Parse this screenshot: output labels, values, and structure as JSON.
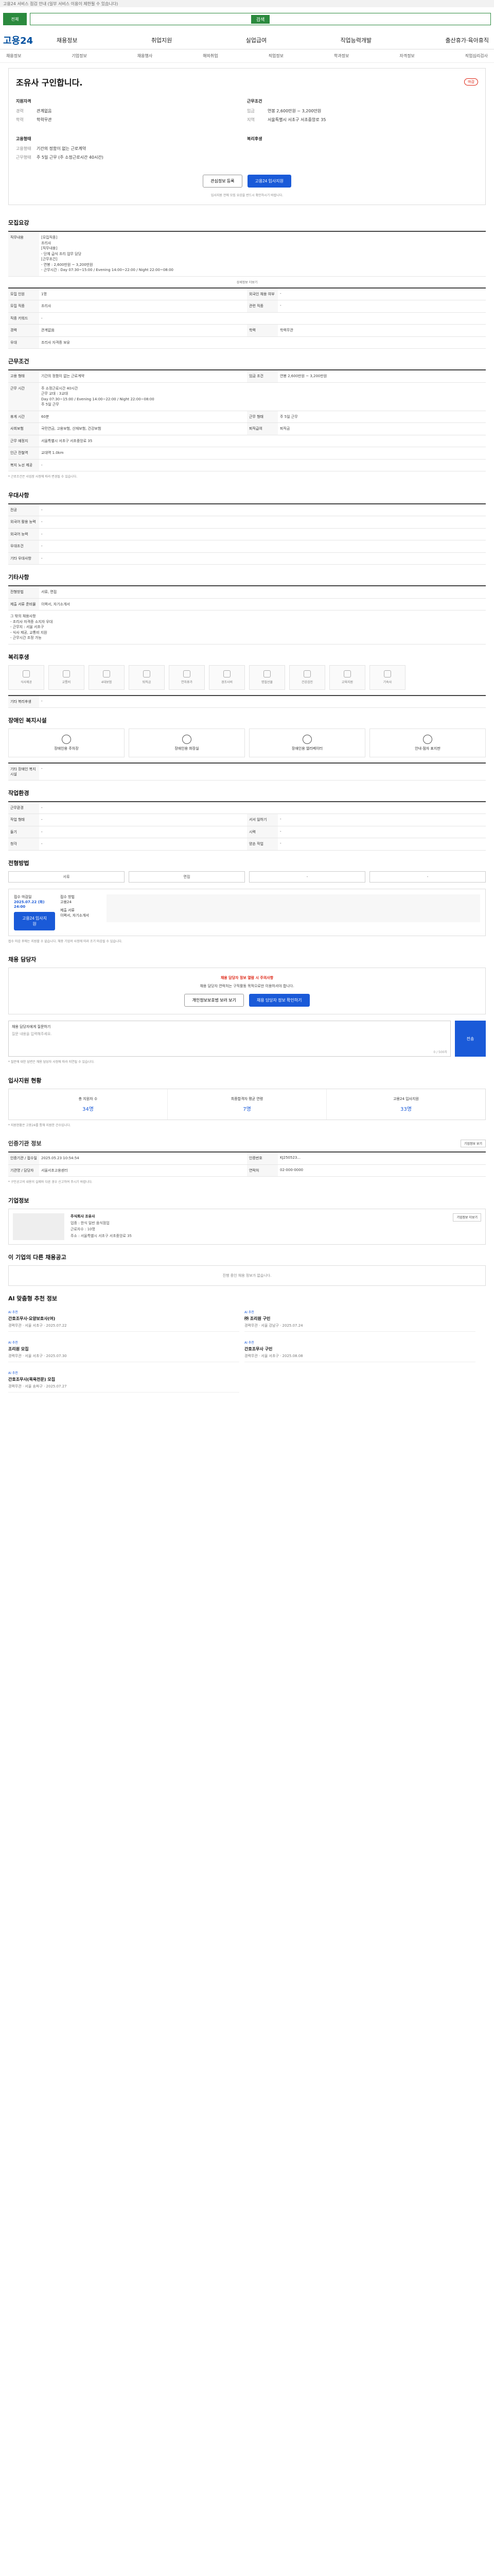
{
  "notice": "고용24 서비스 점검 안내 (일부 서비스 이용이 제한될 수 있습니다)",
  "search": {
    "scope": "전체",
    "button": "검색"
  },
  "logo": "고용24",
  "gnb": [
    "채용정보",
    "취업지원",
    "실업급여",
    "직업능력개발",
    "출산휴가·육아휴직"
  ],
  "lnb": [
    "채용정보",
    "기업정보",
    "채용행사",
    "해외취업",
    "직업정보",
    "학과정보",
    "자격정보",
    "직업심리검사"
  ],
  "company": {
    "name": "조유사 구인합니다.",
    "badge": "마감"
  },
  "summary": {
    "left_title": "지원자격",
    "left": [
      {
        "k": "경력",
        "v": "관계없음"
      },
      {
        "k": "학력",
        "v": "학력무관"
      }
    ],
    "right_title": "근무조건",
    "right": [
      {
        "k": "임금",
        "v": "연봉 2,600만원 ~ 3,200만원"
      },
      {
        "k": "지역",
        "v": "서울특별시 서초구 서초중앙로 35"
      }
    ],
    "left2_title": "고용형태",
    "left2": [
      {
        "k": "고용형태",
        "v": "기간의 정함이 없는 근로계약"
      },
      {
        "k": "근무형태",
        "v": "주 5일 근무 (주 소정근로시간 40시간)"
      }
    ],
    "right2_title": "복리후생",
    "right2": []
  },
  "buttons": {
    "scrap": "관심정보 등록",
    "apply": "고용24 입사지원"
  },
  "apply_note": "입사지원 전에 모집 요강을 반드시 확인하시기 바랍니다.",
  "recruit": {
    "title": "모집요강",
    "rows": [
      {
        "k": "직무내용",
        "v": "[모집직종]\n조리사\n[직무내용]\n- 단체 급식 조리 업무 담당\n[근무조건]\n- 연봉 : 2,600만원 ~ 3,200만원\n- 근무시간 : Day 07:30~15:00 / Evening 14:00~22:00 / Night 22:00~08:00"
      }
    ],
    "toggle": "상세정보 더보기",
    "rows2": [
      {
        "k": "모집 인원",
        "v": "1명",
        "k2": "외국인 채용 여부",
        "v2": "-"
      },
      {
        "k": "모집 직종",
        "v": "조리사",
        "k2": "관련 직종",
        "v2": "-"
      },
      {
        "k": "직종 키워드",
        "v": "-",
        "k2": "",
        "v2": ""
      },
      {
        "k": "경력",
        "v": "관계없음",
        "k2": "학력",
        "v2": "학력무관"
      },
      {
        "k": "우대",
        "v": "조리사 자격증 보유",
        "k2": "",
        "v2": ""
      }
    ]
  },
  "work": {
    "title": "근무조건",
    "rows": [
      {
        "k": "고용 형태",
        "v": "기간의 정함이 없는 근로계약",
        "k2": "임금 조건",
        "v2": "연봉 2,600만원 ~ 3,200만원"
      },
      {
        "k": "근무 시간",
        "v": "주 소정근로시간 40시간\n근무 교대 : 3교대\nDay 07:30~15:00 / Evening 14:00~22:00 / Night 22:00~08:00\n주 5일 근무",
        "k2": "",
        "v2": ""
      },
      {
        "k": "휴게 시간",
        "v": "60분",
        "k2": "근무 형태",
        "v2": "주 5일 근무"
      },
      {
        "k": "사회보험",
        "v": "국민연금, 고용보험, 산재보험, 건강보험",
        "k2": "퇴직급여",
        "v2": "퇴직금"
      },
      {
        "k": "근무 예정지",
        "v": "서울특별시 서초구 서초중앙로 35",
        "k2": "",
        "v2": ""
      },
      {
        "k": "인근 전철역",
        "v": "교대역 1.0km",
        "k2": "",
        "v2": ""
      },
      {
        "k": "복지 노선 제공",
        "v": "-",
        "k2": "",
        "v2": ""
      }
    ],
    "note": "* 근로조건은 사업장 사정에 따라 변경될 수 있습니다."
  },
  "pref": {
    "title": "우대사항",
    "rows": [
      {
        "k": "전공",
        "v": "-"
      },
      {
        "k": "외국어 활용 능력",
        "v": "-"
      },
      {
        "k": "외국어 능력",
        "v": "-"
      },
      {
        "k": "우대조건",
        "v": "-"
      },
      {
        "k": "기타 우대사항",
        "v": "-"
      }
    ]
  },
  "etc": {
    "title": "기타사항",
    "rows": [
      {
        "k": "전형방법",
        "v": "서류, 면접"
      },
      {
        "k": "제출 서류 준비물",
        "v": "이력서, 자기소개서"
      }
    ],
    "detail": "그 밖의 채용사항\n- 조리사 자격증 소지자 우대\n- 근무지 : 서울 서초구\n- 식사 제공, 교통비 지원\n- 근무시간 조정 가능"
  },
  "welfare": {
    "title": "복리후생",
    "items": [
      "식사제공",
      "교통비",
      "4대보험",
      "퇴직금",
      "연차휴가",
      "경조사비",
      "명절선물",
      "건강검진",
      "교육지원",
      "기숙사"
    ],
    "etc_label": "기타 복리후생",
    "etc_value": "-"
  },
  "disability": {
    "title": "장애인 복지시설",
    "items": [
      "장애인용 주차장",
      "장애인용 화장실",
      "장애인용 엘리베이터",
      "안내·점자 표지판"
    ],
    "etc_label": "기타 장애인 복지시설",
    "etc_value": "-"
  },
  "env": {
    "title": "작업환경",
    "rows": [
      {
        "k": "근무환경",
        "v": "-",
        "k2": "",
        "v2": ""
      },
      {
        "k": "작업 형태",
        "v": "-",
        "k2": "서서 일하기",
        "v2": "-"
      },
      {
        "k": "들기",
        "v": "-",
        "k2": "시력",
        "v2": "-"
      },
      {
        "k": "청각",
        "v": "-",
        "k2": "양손 작업",
        "v2": "-"
      }
    ]
  },
  "method": {
    "title": "전형방법",
    "tabs": [
      "서류",
      "면접",
      "-",
      "-"
    ]
  },
  "receipt": {
    "col1_label": "접수 마감일",
    "col1_value": "2025.07.22 (화) 24:00",
    "col2_label": "접수 방법",
    "col2_value": "고용24",
    "col3_label": "제출 서류",
    "col3_value": "이력서, 자기소개서",
    "button": "고용24 입사지원"
  },
  "receipt_note": "접수 마감 후에는 지원할 수 없습니다. 채용 기업의 사정에 따라 조기 마감될 수 있습니다.",
  "manager": {
    "title": "채용 담당자",
    "alert_title": "채용 담당자 정보 열람 시 주의사항",
    "alert_text": "채용 담당자 연락처는 구직활동 목적으로만 이용하셔야 합니다.",
    "btn1": "개인정보보호법 보러 보기",
    "btn2": "채용 담당자 정보 확인하기"
  },
  "qa": {
    "label": "채용 담당자에게 질문하기",
    "placeholder": "질문 내용을 입력해주세요.",
    "count": "0 / 500자",
    "submit": "전송"
  },
  "qa_note": "* 질문에 대한 답변은 채용 담당자 사정에 따라 지연될 수 있습니다.",
  "stats": {
    "title": "입사지원 현황",
    "items": [
      {
        "k": "총 지원자 수",
        "v": "34명"
      },
      {
        "k": "최종합격자 평균 연령",
        "v": "7명"
      },
      {
        "k": "고용24 입사지원",
        "v": "33명"
      }
    ],
    "note": "* 지원현황은 고용24를 통해 지원한 건수입니다."
  },
  "org": {
    "title": "인증기관 정보",
    "more": "기업정보 보기",
    "rows": [
      {
        "k": "인증기관 / 접수일",
        "v": "2025.05.23 10:54:54",
        "k2": "인증번호",
        "v2": "KJ250523..."
      },
      {
        "k": "기관명 / 담당자",
        "v": "서울서초고용센터",
        "k2": "연락처",
        "v2": "02-000-0000"
      }
    ],
    "note": "* 구인공고의 내용이 실제와 다른 경우 신고하여 주시기 바랍니다."
  },
  "company_info": {
    "title": "기업정보",
    "name": "주식회사 조유사",
    "rows": [
      "업종 : 한식 일반 음식점업",
      "근로자수 : 10명",
      "주소 : 서울특별시 서초구 서초중앙로 35"
    ],
    "more": "기업정보 더보기"
  },
  "other_jobs": {
    "title": "이 기업의 다른 채용공고",
    "empty": "진행 중인 채용 정보가 없습니다."
  },
  "recommend": {
    "title": "AI 맞춤형 추천 정보",
    "items": [
      {
        "tag": "AI 추천",
        "name": "간호조무사·요양보호사(여)",
        "meta": "경력무관 · 서울 서초구 · 2025.07.22"
      },
      {
        "tag": "AI 추천",
        "name": "㈜ 조리원 구인",
        "meta": "경력무관 · 서울 강남구 · 2025.07.24"
      },
      {
        "tag": "AI 추천",
        "name": "조리원 모집",
        "meta": "경력무관 · 서울 서초구 · 2025.07.30"
      },
      {
        "tag": "AI 추천",
        "name": "간호조무사 구인",
        "meta": "경력무관 · 서울 서초구 · 2025.08.08"
      },
      {
        "tag": "AI 추천",
        "name": "간호조무사(목욕전문) 모집",
        "meta": "경력무관 · 서울 송파구 · 2025.07.27"
      }
    ]
  }
}
